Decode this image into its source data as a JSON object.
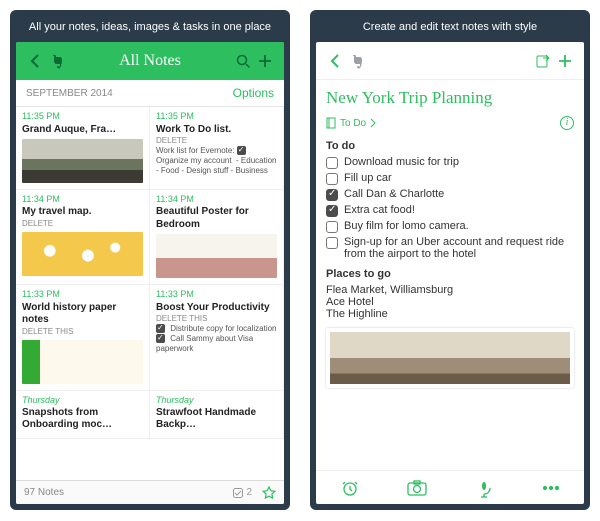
{
  "left": {
    "caption": "All your notes, ideas, images & tasks in one place",
    "header_title": "All Notes",
    "section_date": "SEPTEMBER 2014",
    "options_label": "Options",
    "footer_count": "97 Notes",
    "footer_badge": "2",
    "cards": [
      {
        "time": "11:35 PM",
        "title": "Grand Auque, Fra…"
      },
      {
        "time": "11:35 PM",
        "title": "Work To Do list.",
        "sub": "DELETE",
        "body": "Work list for Evernote:  Organize my account  - Education - Food - Design stuff - Business"
      },
      {
        "time": "11:34 PM",
        "title": "My travel map.",
        "sub": "DELETE"
      },
      {
        "time": "11:34 PM",
        "title": "Beautiful  Poster for Bedroom"
      },
      {
        "time": "11:33 PM",
        "title": "World history paper notes",
        "sub": "DELETE THIS"
      },
      {
        "time": "11:33 PM",
        "title": "Boost Your Productivity",
        "sub": "DELETE THIS",
        "body": " Distribute copy for localization  Call Sammy about Visa paperwork"
      },
      {
        "time": "Thursday",
        "title": "Snapshots from Onboarding moc…"
      },
      {
        "time": "Thursday",
        "title": "Strawfoot Handmade Backp…"
      }
    ]
  },
  "right": {
    "caption": "Create and edit text notes with style",
    "note_title": "New York Trip Planning",
    "tag_label": "To Do",
    "todo_heading": "To do",
    "places_heading": "Places to go",
    "todos": [
      {
        "text": "Download music for trip",
        "done": false
      },
      {
        "text": "Fill up car",
        "done": false
      },
      {
        "text": "Call Dan & Charlotte",
        "done": true
      },
      {
        "text": "Extra cat food!",
        "done": true
      },
      {
        "text": "Buy film for lomo camera.",
        "done": false
      },
      {
        "text": "Sign-up for an Uber account and request ride from the airport to the hotel",
        "done": false
      }
    ],
    "places": [
      "Flea Market, Williamsburg",
      "Ace Hotel",
      "The Highline"
    ]
  }
}
